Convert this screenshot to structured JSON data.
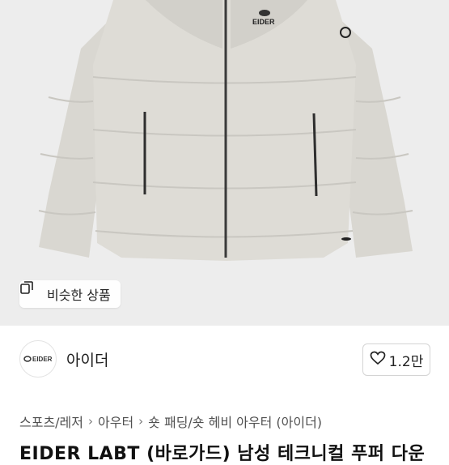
{
  "product_image": {
    "brand_logo": "EIDER",
    "similar_button": {
      "label": "비슷한 상품",
      "icon": "copy-icon"
    }
  },
  "shop": {
    "avatar_logo": "EIDER",
    "name": "아이더",
    "likes": {
      "icon": "heart-icon",
      "count": "1.2만"
    }
  },
  "breadcrumb": {
    "items": [
      "스포츠/레저",
      "아우터",
      "숏 패딩/숏 헤비 아우터 (아이더)"
    ],
    "separator": "›"
  },
  "title": "EIDER LABT (바로가드) 남성 테크니컬 푸퍼 다운",
  "colors": {
    "jacket": "#dad8d2",
    "background": "#ededed",
    "text": "#111111"
  }
}
